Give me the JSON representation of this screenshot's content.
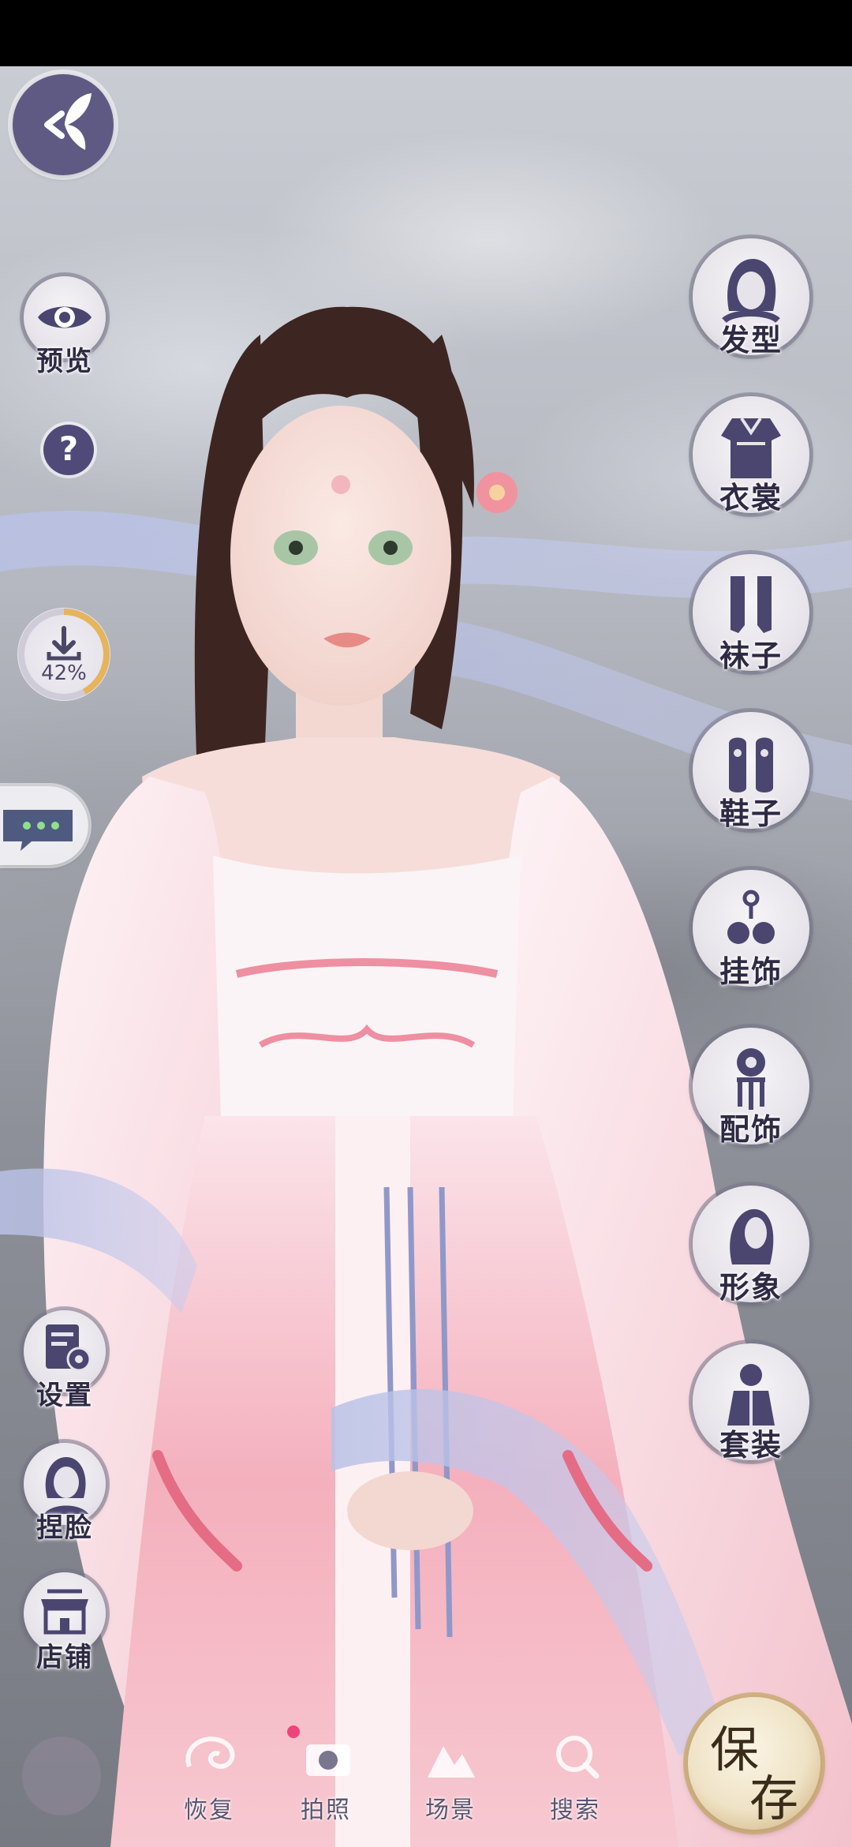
{
  "left_menu": {
    "back": {
      "icon": "butterfly-back-icon"
    },
    "preview": {
      "label": "预览",
      "icon": "eye-icon"
    },
    "help": {
      "label": "?",
      "icon": "help-icon"
    },
    "download": {
      "percent": "42%",
      "progress": 0.42,
      "icon": "download-icon"
    },
    "chat": {
      "icon": "chat-bubble-icon"
    },
    "settings": {
      "label": "设置",
      "icon": "settings-icon"
    },
    "face": {
      "label": "捏脸",
      "icon": "face-icon"
    },
    "shop": {
      "label": "店铺",
      "icon": "shop-icon"
    }
  },
  "right_menu": {
    "items": [
      {
        "label": "发型",
        "icon": "hairstyle-icon"
      },
      {
        "label": "衣裳",
        "icon": "clothing-icon"
      },
      {
        "label": "袜子",
        "icon": "socks-icon"
      },
      {
        "label": "鞋子",
        "icon": "shoes-icon"
      },
      {
        "label": "挂饰",
        "icon": "pendant-icon"
      },
      {
        "label": "配饰",
        "icon": "accessory-icon"
      },
      {
        "label": "形象",
        "icon": "appearance-icon"
      },
      {
        "label": "套装",
        "icon": "outfit-set-icon"
      }
    ]
  },
  "bottom_bar": {
    "items": [
      {
        "label": "恢复",
        "icon": "restore-icon"
      },
      {
        "label": "拍照",
        "icon": "camera-icon"
      },
      {
        "label": "场景",
        "icon": "scene-icon"
      },
      {
        "label": "搜索",
        "icon": "search-icon"
      }
    ],
    "save": {
      "char1": "保",
      "char2": "存"
    }
  },
  "colors": {
    "button_ring": "#78768c",
    "back_button": "#5f5a84",
    "label_text": "#2e2a44",
    "save_gold": "#c9a971",
    "dress_pink": "#f2a8b3",
    "ribbon_lavender": "#b9c1e6"
  }
}
